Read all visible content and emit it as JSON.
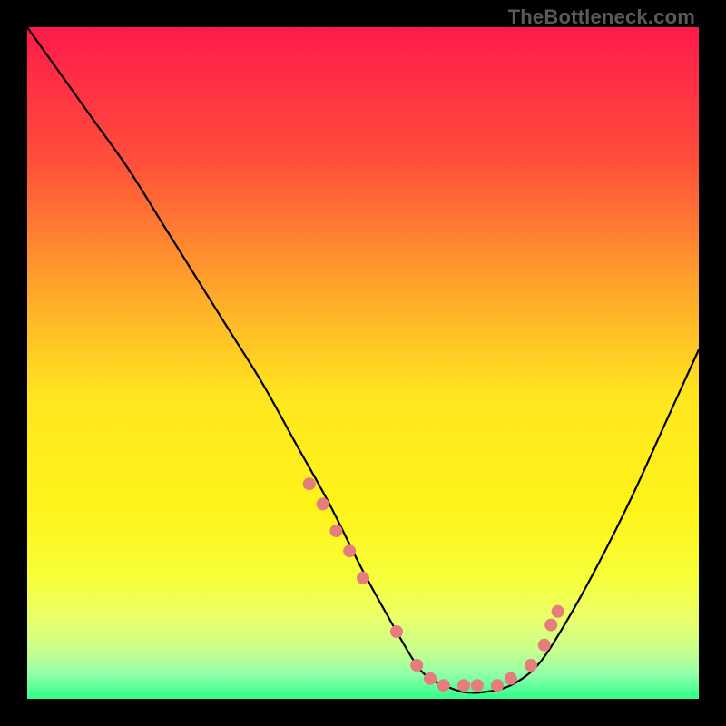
{
  "watermark": "TheBottleneck.com",
  "chart_data": {
    "type": "line",
    "title": "",
    "xlabel": "",
    "ylabel": "",
    "xlim": [
      0,
      100
    ],
    "ylim": [
      0,
      100
    ],
    "grid": false,
    "legend": false,
    "background": {
      "type": "vertical-gradient",
      "stops": [
        {
          "pos": 0.0,
          "color": "#ff1a4b"
        },
        {
          "pos": 0.2,
          "color": "#ff4f3a"
        },
        {
          "pos": 0.4,
          "color": "#ffaa2a"
        },
        {
          "pos": 0.55,
          "color": "#ffe61f"
        },
        {
          "pos": 0.72,
          "color": "#fff41a"
        },
        {
          "pos": 0.82,
          "color": "#f6ff3a"
        },
        {
          "pos": 0.88,
          "color": "#eaff6a"
        },
        {
          "pos": 0.93,
          "color": "#c7ff8f"
        },
        {
          "pos": 0.965,
          "color": "#8effa8"
        },
        {
          "pos": 1.0,
          "color": "#2eff8a"
        }
      ]
    },
    "series": [
      {
        "name": "bottleneck-curve",
        "color": "#000000",
        "x": [
          0,
          5,
          10,
          15,
          20,
          25,
          30,
          35,
          40,
          45,
          50,
          55,
          58,
          60,
          62,
          65,
          68,
          72,
          76,
          80,
          85,
          90,
          95,
          100
        ],
        "y": [
          100,
          93,
          86,
          79,
          71,
          63,
          55,
          47,
          38,
          29,
          19,
          10,
          5,
          3,
          2,
          1,
          1,
          2,
          5,
          11,
          20,
          30,
          41,
          52
        ]
      }
    ],
    "markers": {
      "name": "highlight-dots",
      "color": "#e77c7c",
      "radius": 7,
      "x": [
        42,
        44,
        46,
        48,
        50,
        55,
        58,
        60,
        62,
        65,
        67,
        70,
        72,
        75,
        77,
        78,
        79
      ],
      "y": [
        32,
        29,
        25,
        22,
        18,
        10,
        5,
        3,
        2,
        2,
        2,
        2,
        3,
        5,
        8,
        11,
        13
      ]
    }
  }
}
